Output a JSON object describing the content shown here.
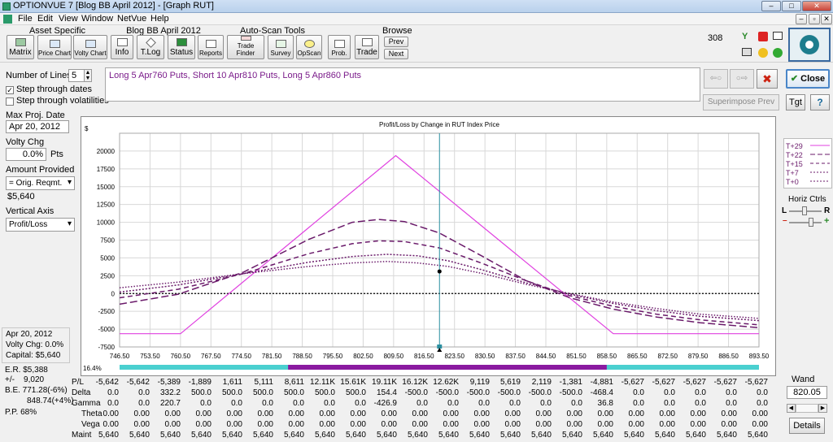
{
  "window": {
    "title": "OPTIONVUE 7  [Blog BB April 2012] - [Graph RUT]",
    "min": "–",
    "max": "□",
    "close": "✕"
  },
  "menu": {
    "items": [
      "File",
      "Edit",
      "View",
      "Window",
      "NetVue",
      "Help"
    ],
    "child_min": "–",
    "child_restore": "▫",
    "child_close": "✕"
  },
  "toolbar": {
    "groups": [
      "Asset Specific",
      "Blog BB April 2012",
      "Auto-Scan Tools",
      "Browse"
    ],
    "buttons": [
      "Matrix",
      "Price Chart",
      "Volty Chart",
      "Info",
      "T.Log",
      "Status",
      "Reports",
      "Trade Finder",
      "Survey",
      "OpScan",
      "Prob.",
      "Trade"
    ],
    "prev": "Prev",
    "next": "Next",
    "count": "308"
  },
  "left": {
    "num_lines_label": "Number of Lines",
    "num_lines_value": "5",
    "step_dates": "Step through dates",
    "step_vols": "Step through volatilities",
    "max_proj_label": "Max Proj. Date",
    "max_proj_value": "Apr 20, 2012",
    "volty_label": "Volty Chg",
    "volty_value": "0.0%",
    "volty_unit": "Pts",
    "amount_label": "Amount Provided",
    "amount_value": "= Orig. Reqmt.",
    "amount_amt": "$5,640",
    "vaxis_label": "Vertical Axis",
    "vaxis_value": "Profit/Loss",
    "info_date": "Apr 20, 2012",
    "info_volty": "Volty Chg:  0.0%",
    "info_capital": "Capital:  $5,640",
    "er": "E.R. $5,388",
    "pm": "+/-    9,020",
    "be1": "B.E. 771.28(-6%)",
    "be2": "848.74(+4%)",
    "pp": "P.P.  68%"
  },
  "position_text": "Long 5 Apr760 Puts, Short 10 Apr810 Puts, Long 5 Apr860 Puts",
  "right": {
    "close": "Close",
    "superimpose": "Superimpose Prev",
    "tgt": "Tgt",
    "help": "?",
    "horiz": "Horiz Ctrls",
    "L": "L",
    "R": "R",
    "minus": "–",
    "plus": "+",
    "wand": "Wand",
    "wand_value": "820.05",
    "details": "Details",
    "prev_arrow": "⇦○",
    "next_arrow": "○⇨",
    "x": "✖"
  },
  "legend": [
    {
      "label": "T+29",
      "style": "solid"
    },
    {
      "label": "T+22",
      "style": "longdash"
    },
    {
      "label": "T+15",
      "style": "dash"
    },
    {
      "label": "T+7",
      "style": "dot"
    },
    {
      "label": "T+0",
      "style": "dot"
    }
  ],
  "chart_data": {
    "type": "line",
    "title": "Profit/Loss by Change in RUT Index Price",
    "ylabel": "$",
    "xlabel": "",
    "ylim": [
      -7500,
      22500
    ],
    "xlim": [
      746.5,
      893.5
    ],
    "yticks": [
      "20000",
      "17500",
      "15000",
      "12500",
      "10000",
      "7500",
      "5000",
      "2500",
      "0",
      "-2500",
      "-5000",
      "-7500"
    ],
    "xticks": [
      "746.50",
      "753.50",
      "760.50",
      "767.50",
      "774.50",
      "781.50",
      "788.50",
      "795.50",
      "802.50",
      "809.50",
      "816.50",
      "823.50",
      "830.50",
      "837.50",
      "844.50",
      "851.50",
      "858.50",
      "865.50",
      "872.50",
      "879.50",
      "886.50",
      "893.50"
    ],
    "wand_x": 820.05,
    "wand_point_y": 3100,
    "pct_label": "16.4%",
    "series": [
      {
        "name": "T+29",
        "color": "#e040e0",
        "points": [
          [
            746.5,
            -5640
          ],
          [
            760.5,
            -5640
          ],
          [
            810,
            19360
          ],
          [
            860,
            -5640
          ],
          [
            893.5,
            -5640
          ]
        ]
      },
      {
        "name": "T+22",
        "color": "#6a1a6a",
        "points": [
          [
            746.5,
            -1500
          ],
          [
            760,
            -100
          ],
          [
            775,
            3000
          ],
          [
            790,
            7600
          ],
          [
            800,
            10000
          ],
          [
            806,
            10400
          ],
          [
            812,
            10100
          ],
          [
            820,
            8500
          ],
          [
            830,
            5200
          ],
          [
            840,
            1800
          ],
          [
            850,
            -600
          ],
          [
            860,
            -2200
          ],
          [
            870,
            -3300
          ],
          [
            880,
            -4100
          ],
          [
            893.5,
            -4800
          ]
        ]
      },
      {
        "name": "T+15",
        "color": "#6a1a6a",
        "points": [
          [
            746.5,
            -600
          ],
          [
            760,
            600
          ],
          [
            775,
            2800
          ],
          [
            790,
            5600
          ],
          [
            800,
            7000
          ],
          [
            806,
            7400
          ],
          [
            812,
            7300
          ],
          [
            820,
            6400
          ],
          [
            830,
            4200
          ],
          [
            840,
            1800
          ],
          [
            850,
            -300
          ],
          [
            860,
            -1800
          ],
          [
            870,
            -2900
          ],
          [
            880,
            -3700
          ],
          [
            893.5,
            -4400
          ]
        ]
      },
      {
        "name": "T+7",
        "color": "#6a1a6a",
        "points": [
          [
            746.5,
            200
          ],
          [
            760,
            1200
          ],
          [
            775,
            2800
          ],
          [
            790,
            4400
          ],
          [
            800,
            5200
          ],
          [
            808,
            5500
          ],
          [
            815,
            5300
          ],
          [
            822,
            4600
          ],
          [
            830,
            3300
          ],
          [
            840,
            1500
          ],
          [
            850,
            -100
          ],
          [
            860,
            -1400
          ],
          [
            870,
            -2400
          ],
          [
            880,
            -3200
          ],
          [
            893.5,
            -3800
          ]
        ]
      },
      {
        "name": "T+0",
        "color": "#6a1a6a",
        "points": [
          [
            746.5,
            800
          ],
          [
            760,
            1600
          ],
          [
            775,
            2800
          ],
          [
            790,
            3800
          ],
          [
            800,
            4300
          ],
          [
            808,
            4500
          ],
          [
            815,
            4300
          ],
          [
            822,
            3800
          ],
          [
            830,
            2800
          ],
          [
            840,
            1300
          ],
          [
            850,
            0
          ],
          [
            860,
            -1200
          ],
          [
            870,
            -2100
          ],
          [
            880,
            -2900
          ],
          [
            893.5,
            -3500
          ]
        ]
      }
    ]
  },
  "table": {
    "labels": [
      "P/L",
      "Delta",
      "Gamma",
      "Theta",
      "Vega",
      "Maint"
    ],
    "rows": [
      [
        "-5,642",
        "-5,642",
        "-5,389",
        "-1,889",
        "1,611",
        "5,111",
        "8,611",
        "12.11K",
        "15.61K",
        "19.11K",
        "16.12K",
        "12.62K",
        "9,119",
        "5,619",
        "2,119",
        "-1,381",
        "-4,881",
        "-5,627",
        "-5,627",
        "-5,627",
        "-5,627",
        "-5,627"
      ],
      [
        "0.0",
        "0.0",
        "332.2",
        "500.0",
        "500.0",
        "500.0",
        "500.0",
        "500.0",
        "500.0",
        "154.4",
        "-500.0",
        "-500.0",
        "-500.0",
        "-500.0",
        "-500.0",
        "-500.0",
        "-468.4",
        "0.0",
        "0.0",
        "0.0",
        "0.0",
        "0.0"
      ],
      [
        "0.0",
        "0.0",
        "220.7",
        "0.0",
        "0.0",
        "0.0",
        "0.0",
        "0.0",
        "0.0",
        "-426.9",
        "0.0",
        "0.0",
        "0.0",
        "0.0",
        "0.0",
        "0.0",
        "36.8",
        "0.0",
        "0.0",
        "0.0",
        "0.0",
        "0.0"
      ],
      [
        "0.00",
        "0.00",
        "0.00",
        "0.00",
        "0.00",
        "0.00",
        "0.00",
        "0.00",
        "0.00",
        "0.00",
        "0.00",
        "0.00",
        "0.00",
        "0.00",
        "0.00",
        "0.00",
        "0.00",
        "0.00",
        "0.00",
        "0.00",
        "0.00",
        "0.00"
      ],
      [
        "0.00",
        "0.00",
        "0.00",
        "0.00",
        "0.00",
        "0.00",
        "0.00",
        "0.00",
        "0.00",
        "0.00",
        "0.00",
        "0.00",
        "0.00",
        "0.00",
        "0.00",
        "0.00",
        "0.00",
        "0.00",
        "0.00",
        "0.00",
        "0.00",
        "0.00"
      ],
      [
        "5,640",
        "5,640",
        "5,640",
        "5,640",
        "5,640",
        "5,640",
        "5,640",
        "5,640",
        "5,640",
        "5,640",
        "5,640",
        "5,640",
        "5,640",
        "5,640",
        "5,640",
        "5,640",
        "5,640",
        "5,640",
        "5,640",
        "5,640",
        "5,640",
        "5,640"
      ]
    ]
  }
}
